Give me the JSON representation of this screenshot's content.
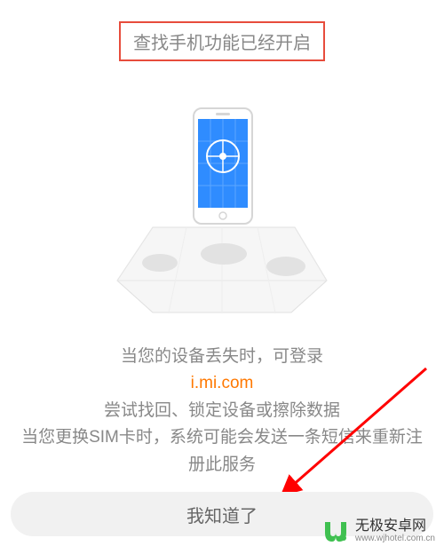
{
  "title": "查找手机功能已经开启",
  "description": {
    "line1": "当您的设备丢失时，可登录",
    "link": "i.mi.com",
    "line2": "尝试找回、锁定设备或擦除数据",
    "line3": "当您更换SIM卡时，系统可能会发送一条短信来重新注册此服务"
  },
  "button": {
    "confirm": "我知道了"
  },
  "watermark": {
    "name": "无极安卓网",
    "url": "www.wjhotel.com.cn"
  }
}
